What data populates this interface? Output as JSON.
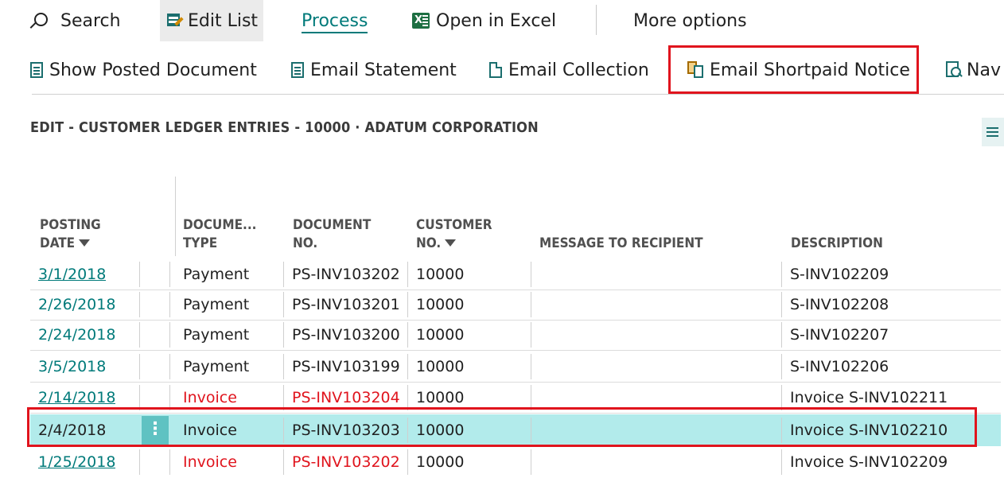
{
  "toolbar": {
    "search_label": "Search",
    "edit_list_label": "Edit List",
    "process_label": "Process",
    "open_excel_label": "Open in Excel",
    "more_options_label": "More options"
  },
  "actions": {
    "show_posted_document": "Show Posted Document",
    "email_statement": "Email Statement",
    "email_collection": "Email Collection",
    "email_shortpaid_notice": "Email Shortpaid Notice",
    "navigate": "Nav"
  },
  "page": {
    "title": "EDIT - CUSTOMER LEDGER ENTRIES - 10000 · ADATUM CORPORATION"
  },
  "columns": {
    "posting_date": [
      "POSTING",
      "DATE"
    ],
    "document_type": [
      "DOCUME...",
      "TYPE"
    ],
    "document_no": [
      "DOCUMENT",
      "NO."
    ],
    "customer_no": [
      "CUSTOMER",
      "NO."
    ],
    "message": "MESSAGE TO RECIPIENT",
    "description": "DESCRIPTION"
  },
  "rows": [
    {
      "posting_date": "3/1/2018",
      "doc_type": "Payment",
      "doc_no": "PS-INV103202",
      "customer_no": "10000",
      "message": "",
      "description": "S-INV102209"
    },
    {
      "posting_date": "2/26/2018",
      "doc_type": "Payment",
      "doc_no": "PS-INV103201",
      "customer_no": "10000",
      "message": "",
      "description": "S-INV102208"
    },
    {
      "posting_date": "2/24/2018",
      "doc_type": "Payment",
      "doc_no": "PS-INV103200",
      "customer_no": "10000",
      "message": "",
      "description": "S-INV102207"
    },
    {
      "posting_date": "3/5/2018",
      "doc_type": "Payment",
      "doc_no": "PS-INV103199",
      "customer_no": "10000",
      "message": "",
      "description": "S-INV102206"
    },
    {
      "posting_date": "2/14/2018",
      "doc_type": "Invoice",
      "doc_no": "PS-INV103204",
      "customer_no": "10000",
      "message": "",
      "description": "Invoice S-INV102211"
    },
    {
      "posting_date": "2/4/2018",
      "doc_type": "Invoice",
      "doc_no": "PS-INV103203",
      "customer_no": "10000",
      "message": "",
      "description": "Invoice S-INV102210"
    },
    {
      "posting_date": "1/25/2018",
      "doc_type": "Invoice",
      "doc_no": "PS-INV103202",
      "customer_no": "10000",
      "message": "",
      "description": "Invoice S-INV102209"
    }
  ],
  "row_menu_glyph": "⋮",
  "colors": {
    "accent": "#007a7a",
    "overdue": "#e0141d",
    "selected_row": "#b2ebeb",
    "highlight_box": "#e0141d"
  }
}
